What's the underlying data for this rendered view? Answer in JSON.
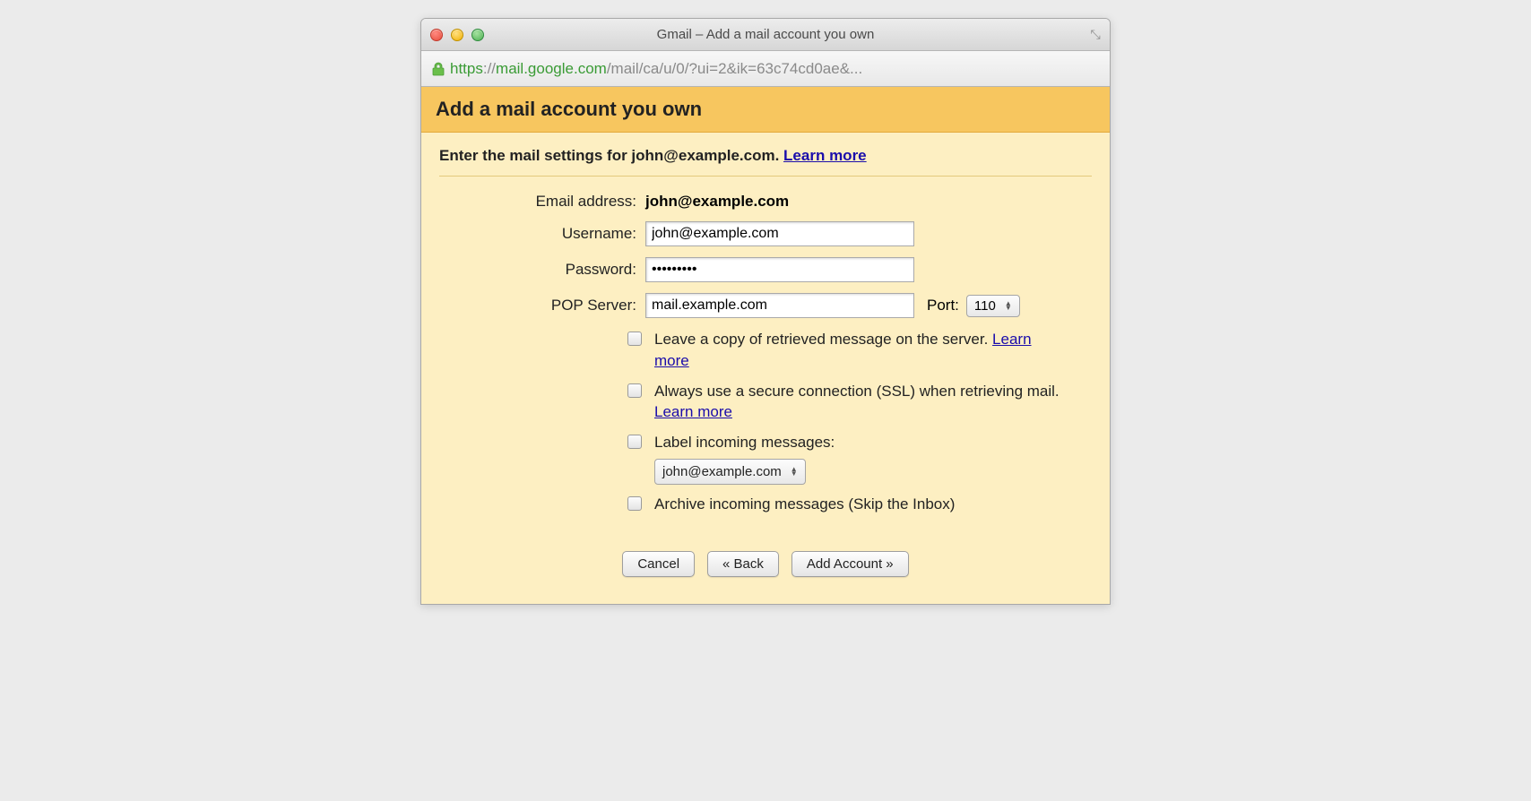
{
  "window": {
    "title": "Gmail – Add a mail account you own"
  },
  "addressbar": {
    "https": "https",
    "sep": "://",
    "host": "mail.google.com",
    "path": "/mail/ca/u/0/?ui=2&ik=63c74cd0ae&..."
  },
  "header": {
    "title": "Add a mail account you own"
  },
  "instruction": {
    "prefix": "Enter the mail settings for john@example.com. ",
    "learn_more": "Learn more"
  },
  "form": {
    "email_label": "Email address:",
    "email_value": "john@example.com",
    "username_label": "Username:",
    "username_value": "john@example.com",
    "password_label": "Password:",
    "password_value": "•••••••••",
    "pop_label": "POP Server:",
    "pop_value": "mail.example.com",
    "port_label": "Port:",
    "port_value": "110"
  },
  "options": {
    "leave_copy_text": "Leave a copy of retrieved message on the server. ",
    "leave_copy_link": "Learn more",
    "ssl_text": "Always use a secure connection (SSL) when retrieving mail. ",
    "ssl_link": "Learn more",
    "label_text": "Label incoming messages:",
    "label_select_value": "john@example.com",
    "archive_text": "Archive incoming messages (Skip the Inbox)"
  },
  "buttons": {
    "cancel": "Cancel",
    "back": "« Back",
    "add": "Add Account »"
  }
}
